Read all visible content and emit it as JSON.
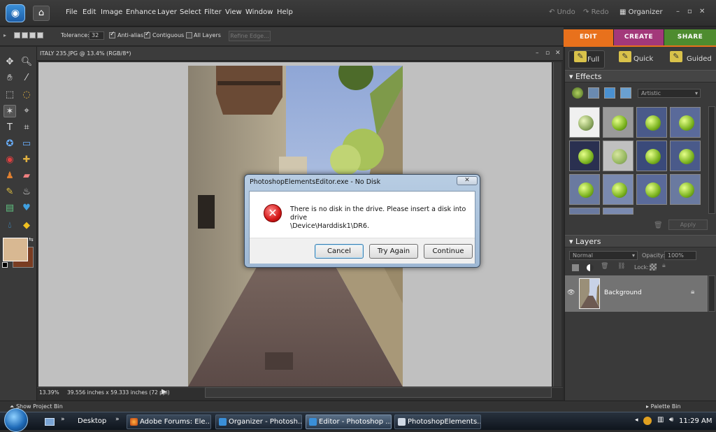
{
  "menubar": {
    "items": [
      "File",
      "Edit",
      "Image",
      "Enhance",
      "Layer",
      "Select",
      "Filter",
      "View",
      "Window",
      "Help"
    ],
    "undo": "Undo",
    "redo": "Redo",
    "organizer": "Organizer"
  },
  "options": {
    "tolerance_label": "Tolerance:",
    "tolerance_value": "32",
    "anti_alias": "Anti-alias",
    "contiguous": "Contiguous",
    "all_layers": "All Layers",
    "refine_edge": "Refine Edge..."
  },
  "mode_tabs": [
    {
      "label": "EDIT",
      "color": "#e8711c"
    },
    {
      "label": "CREATE",
      "color": "#a3387a"
    },
    {
      "label": "SHARE",
      "color": "#4e8c2f"
    }
  ],
  "edit_subtabs": [
    "Full",
    "Quick",
    "Guided"
  ],
  "document": {
    "title": "ITALY 235.JPG @ 13.4% (RGB/8*)",
    "zoom": "13.39%",
    "dimensions": "39.556 inches x 59.333 inches (72 ppi)"
  },
  "effects": {
    "header": "Effects",
    "category": "Artistic",
    "apply": "Apply"
  },
  "layers": {
    "header": "Layers",
    "blend_mode": "Normal",
    "opacity_label": "Opacity:",
    "opacity_value": "100%",
    "lock_label": "Lock:",
    "layer_name": "Background"
  },
  "bins": {
    "project_bin": "Show Project Bin",
    "palette_bin": "Palette Bin"
  },
  "dialog": {
    "title": "PhotoshopElementsEditor.exe - No Disk",
    "message_line1": "There is no disk in the drive. Please insert a disk into drive",
    "message_line2": "\\Device\\Harddisk1\\DR6.",
    "cancel": "Cancel",
    "try_again": "Try Again",
    "continue": "Continue"
  },
  "taskbar": {
    "desktop": "Desktop",
    "tasks": [
      "Adobe Forums: Ele...",
      "Organizer - Photosh...",
      "Editor - Photoshop ...",
      "PhotoshopElements..."
    ],
    "clock": "11:29 AM"
  }
}
